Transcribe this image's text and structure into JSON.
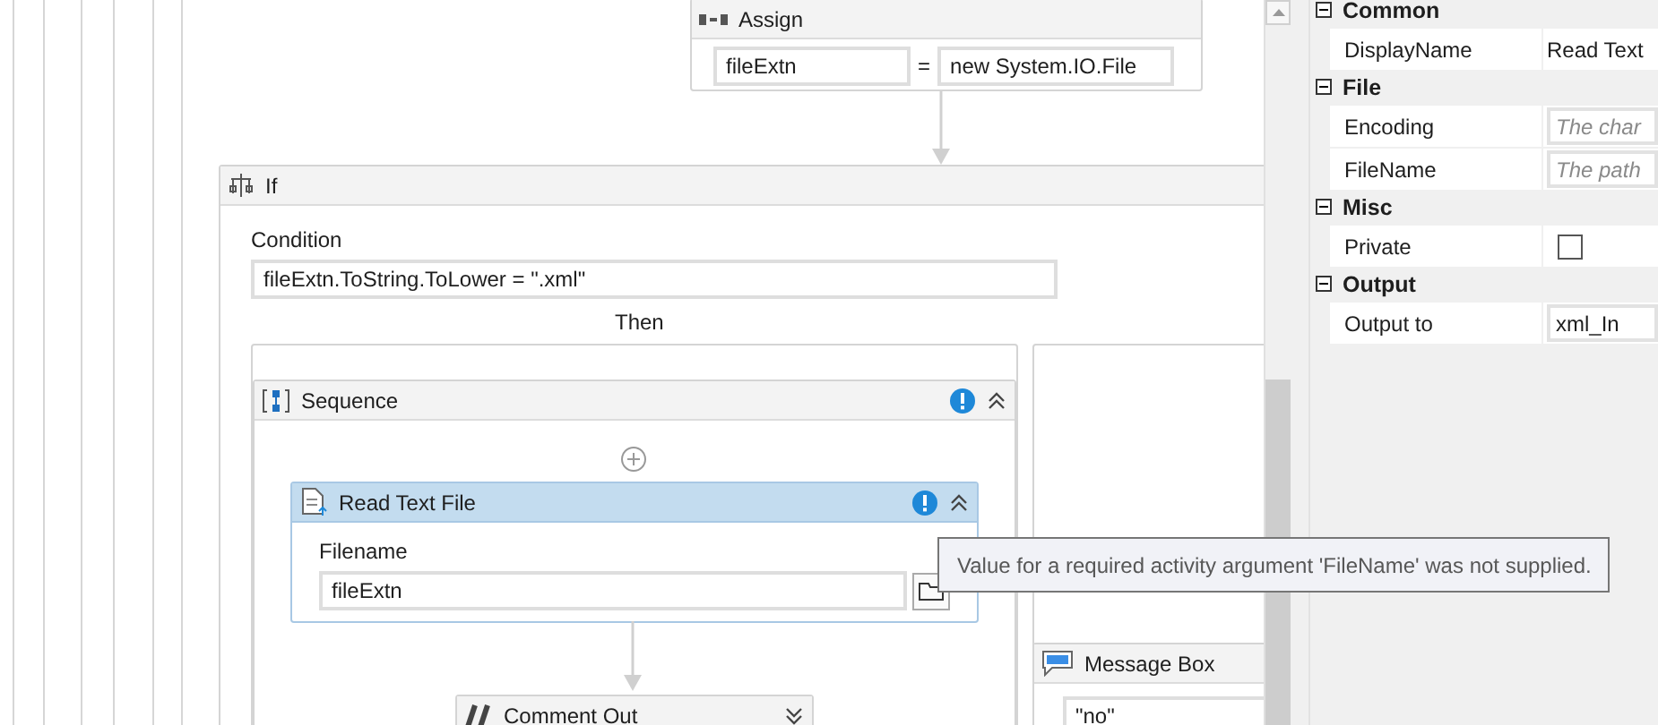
{
  "assign": {
    "title": "Assign",
    "to": "fileExtn",
    "operator": "=",
    "value": "new System.IO.File"
  },
  "if_activity": {
    "title": "If",
    "condition_label": "Condition",
    "condition": "fileExtn.ToString.ToLower = \".xml\"",
    "then_label": "Then"
  },
  "sequence": {
    "title": "Sequence",
    "has_error": true,
    "expanded": true
  },
  "read_text_file": {
    "title": "Read Text File",
    "selected": true,
    "has_error": true,
    "expanded": true,
    "filename_label": "Filename",
    "filename": "fileExtn"
  },
  "comment_out": {
    "title": "Comment Out",
    "expanded": false
  },
  "message_box": {
    "title": "Message Box",
    "text": "\"no\""
  },
  "tooltip": {
    "text": "Value for a required activity argument 'FileName' was not supplied."
  },
  "properties": [
    {
      "category": "Common",
      "expanded": true,
      "rows": [
        {
          "name": "DisplayName",
          "kind": "text",
          "value": "Read Text"
        }
      ]
    },
    {
      "category": "File",
      "expanded": true,
      "rows": [
        {
          "name": "Encoding",
          "kind": "field",
          "placeholder": "The char"
        },
        {
          "name": "FileName",
          "kind": "field",
          "placeholder": "The path"
        }
      ]
    },
    {
      "category": "Misc",
      "expanded": true,
      "rows": [
        {
          "name": "Private",
          "kind": "checkbox",
          "checked": false
        }
      ]
    },
    {
      "category": "Output",
      "expanded": true,
      "rows": [
        {
          "name": "Output to",
          "kind": "field",
          "value": "xml_In"
        }
      ]
    }
  ]
}
